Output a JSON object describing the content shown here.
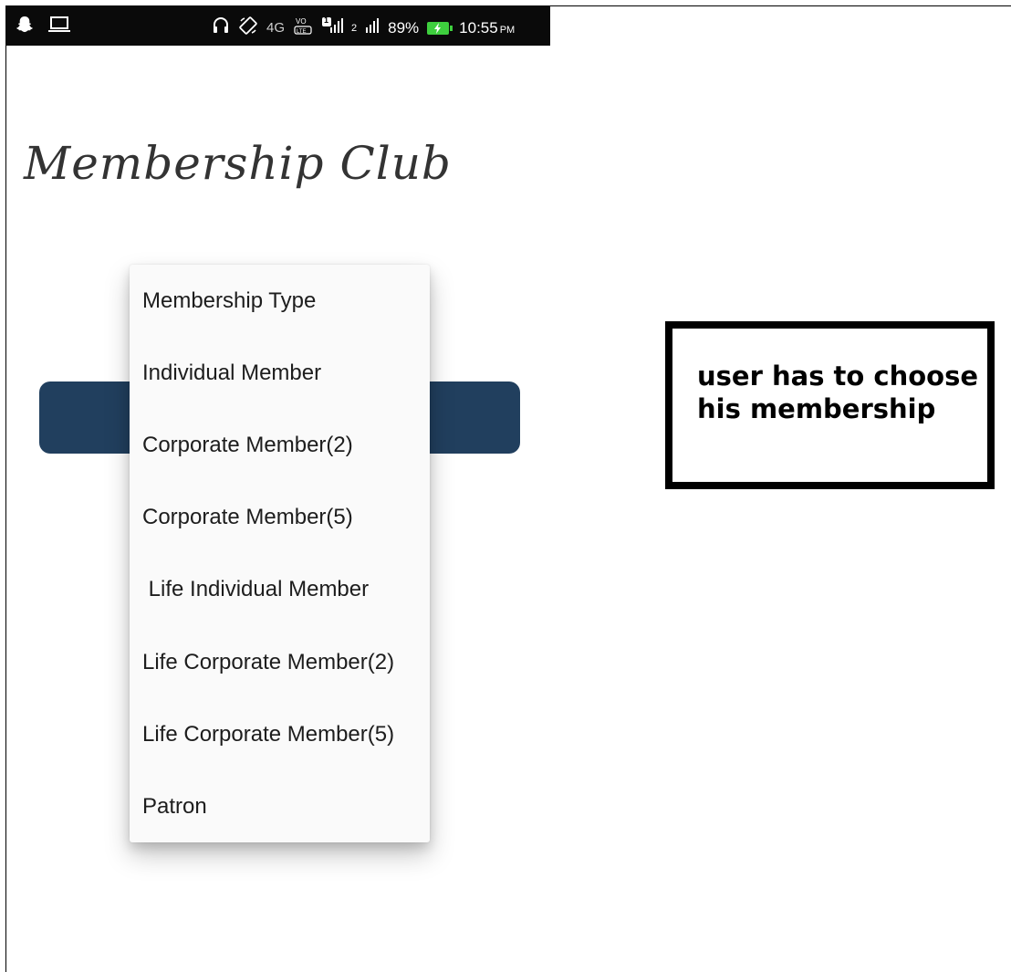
{
  "status_bar": {
    "network": "4G",
    "sim_badge": "1",
    "sim2": "2",
    "battery": "89%",
    "time": "10:55",
    "ampm": "PM",
    "icons": [
      "snapchat-icon",
      "laptop-icon",
      "headphones-icon",
      "rotation-icon",
      "volte-icon",
      "signal-icon",
      "battery-icon"
    ]
  },
  "app": {
    "title": "Membership Club"
  },
  "dropdown": {
    "options": [
      "Membership Type",
      "Individual Member",
      "Corporate Member(2)",
      "Corporate Member(5)",
      " Life Individual Member",
      "Life Corporate Member(2)",
      "Life Corporate Member(5)",
      "Patron"
    ]
  },
  "annotation": {
    "text": "user has to choose his membership"
  },
  "colors": {
    "select_bar": "#213f5e",
    "dropdown_bg": "#fafafa",
    "battery": "#3ecf3e"
  }
}
